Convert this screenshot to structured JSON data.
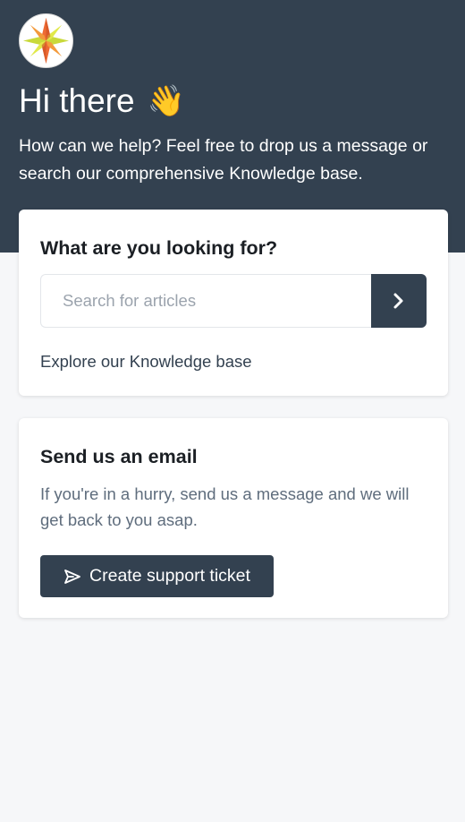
{
  "header": {
    "logo_icon": "compass-star-logo",
    "greeting": "Hi there",
    "greeting_emoji": "👋",
    "intro": "How can we help? Feel free to drop us a message or search our comprehensive Knowledge base.",
    "background_color": "#334150"
  },
  "search_card": {
    "title": "What are you looking for?",
    "search_placeholder": "Search for articles",
    "search_value": "",
    "search_button_icon": "chevron-right-icon",
    "explore_link": "Explore our Knowledge base"
  },
  "email_card": {
    "title": "Send us an email",
    "description": "If you're in a hurry, send us a message and we will get back to you asap.",
    "button_icon": "send-icon",
    "button_label": "Create support ticket"
  },
  "colors": {
    "accent": "#334150",
    "page_background": "#f6f7f9",
    "card_background": "#ffffff"
  }
}
